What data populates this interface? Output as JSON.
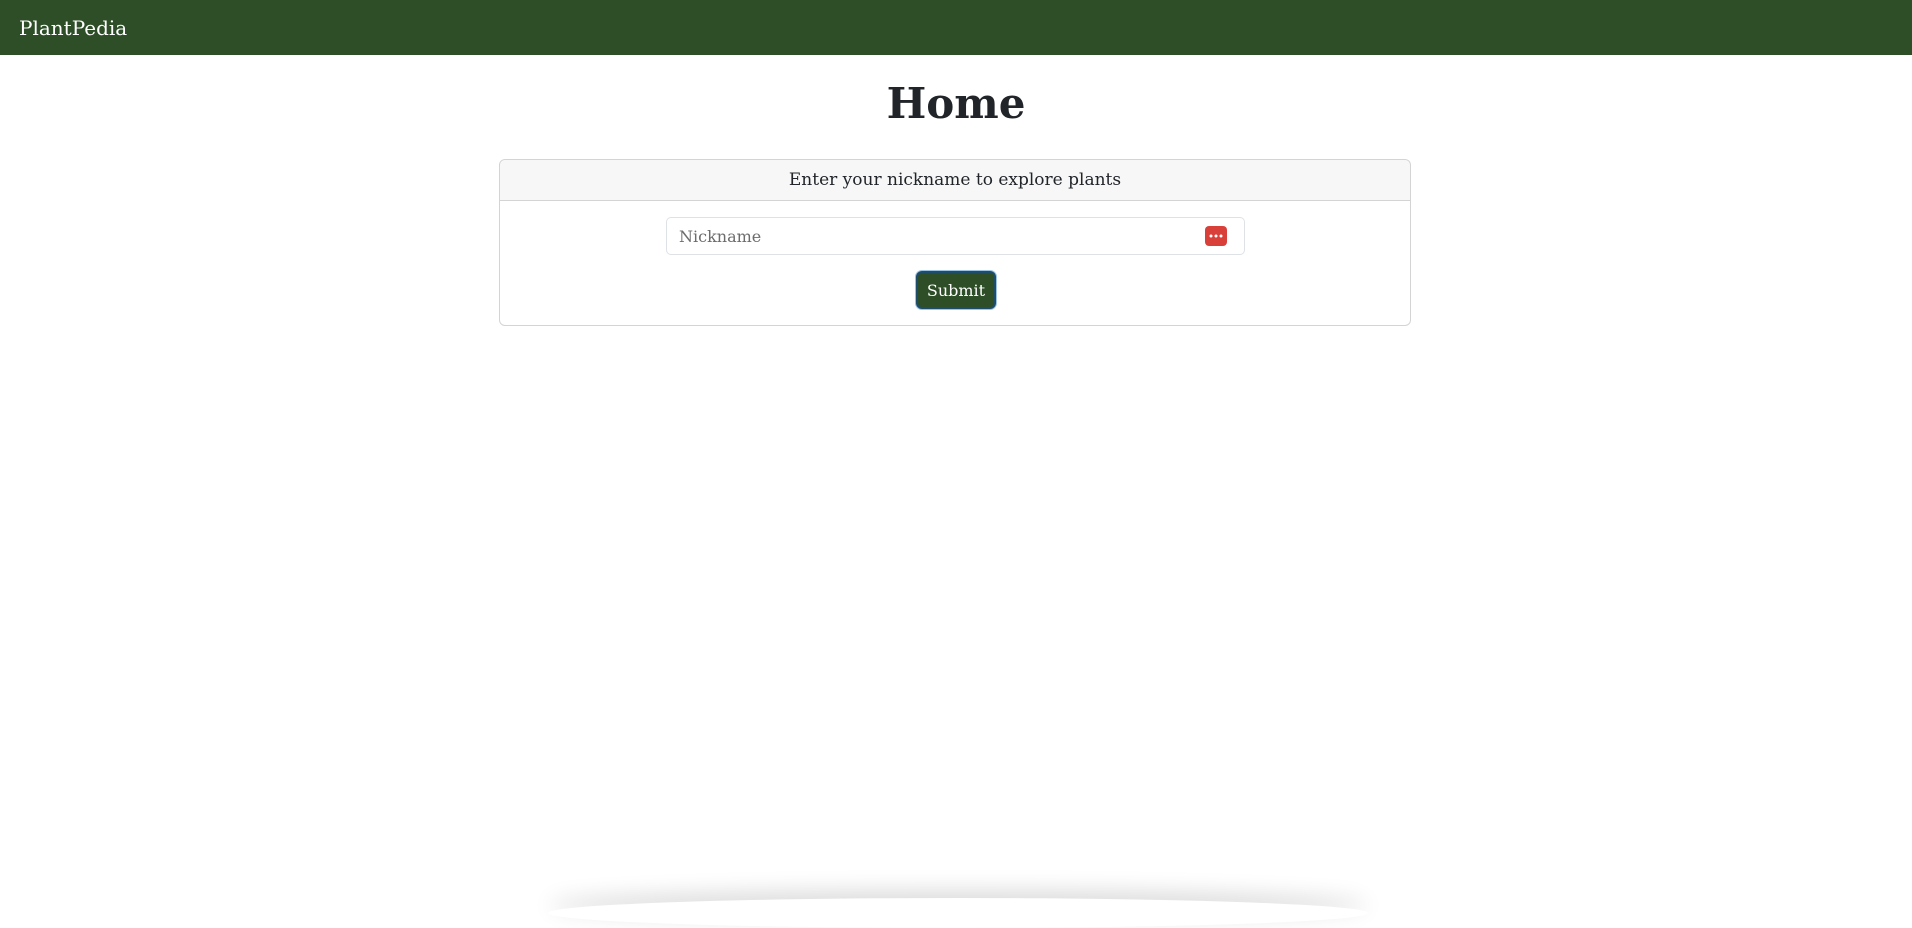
{
  "navbar": {
    "brand": "PlantPedia"
  },
  "main": {
    "title": "Home",
    "card": {
      "header": "Enter your nickname to explore plants",
      "nickname_placeholder": "Nickname",
      "nickname_value": "",
      "submit_label": "Submit"
    }
  },
  "colors": {
    "navbar_bg": "#2d4e27",
    "button_bg": "#2d4e27",
    "password_manager_icon": "#d9403a"
  },
  "icons": {
    "input_addon": "password-manager-icon"
  }
}
